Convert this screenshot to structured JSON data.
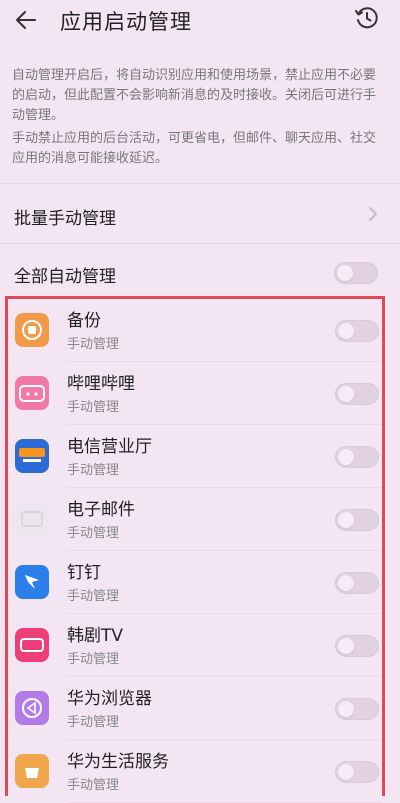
{
  "header": {
    "title": "应用启动管理",
    "back_icon": "arrow-left-icon",
    "history_icon": "clock-history-icon"
  },
  "description": {
    "para1": "自动管理开启后，将自动识别应用和使用场景，禁止应用不必要的启动，但此配置不会影响新消息的及时接收。关闭后可进行手动管理。",
    "para2": "手动禁止应用的后台活动，可更省电，但邮件、聊天应用、社交应用的消息可能接收延迟。"
  },
  "batch_manual": {
    "label": "批量手动管理"
  },
  "all_auto": {
    "label": "全部自动管理",
    "enabled": false
  },
  "apps": [
    {
      "name": "备份",
      "status": "手动管理",
      "icon": "backup-icon",
      "color": "#f39a4a",
      "enabled": false
    },
    {
      "name": "哔哩哔哩",
      "status": "手动管理",
      "icon": "bilibili-icon",
      "color": "#f07aa5",
      "enabled": false
    },
    {
      "name": "电信营业厅",
      "status": "手动管理",
      "icon": "telecom-icon",
      "color": "#2b6bd6",
      "enabled": false
    },
    {
      "name": "电子邮件",
      "status": "手动管理",
      "icon": "email-icon",
      "color": "#ece7ee",
      "enabled": false
    },
    {
      "name": "钉钉",
      "status": "手动管理",
      "icon": "dingtalk-icon",
      "color": "#2b7fe8",
      "enabled": false
    },
    {
      "name": "韩剧TV",
      "status": "手动管理",
      "icon": "hanjutv-icon",
      "color": "#ee3f7a",
      "enabled": false
    },
    {
      "name": "华为浏览器",
      "status": "手动管理",
      "icon": "browser-icon",
      "color": "#b47be8",
      "enabled": false
    },
    {
      "name": "华为生活服务",
      "status": "手动管理",
      "icon": "life-service-icon",
      "color": "#f1a64c",
      "enabled": false
    }
  ],
  "colors": {
    "background": "#f3e6f2",
    "highlight_border": "#e04a57"
  }
}
